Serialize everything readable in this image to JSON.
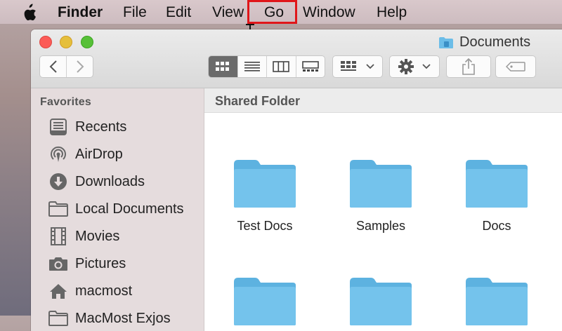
{
  "menubar": {
    "app_name": "Finder",
    "items": [
      "File",
      "Edit",
      "View",
      "Go",
      "Window",
      "Help"
    ],
    "highlighted_item": "Go",
    "highlight_color": "#e0161a"
  },
  "window": {
    "title": "Documents",
    "traffic_lights": [
      "#fc5b57",
      "#e5bf3c",
      "#57c038"
    ],
    "toolbar": {
      "view_modes": [
        "icon-view",
        "list-view",
        "column-view",
        "gallery-view"
      ],
      "active_view": "icon-view"
    }
  },
  "sidebar": {
    "header": "Favorites",
    "items": [
      {
        "label": "Recents",
        "icon": "recents-icon"
      },
      {
        "label": "AirDrop",
        "icon": "airdrop-icon"
      },
      {
        "label": "Downloads",
        "icon": "downloads-icon"
      },
      {
        "label": "Local Documents",
        "icon": "folder-icon"
      },
      {
        "label": "Movies",
        "icon": "movies-icon"
      },
      {
        "label": "Pictures",
        "icon": "camera-icon"
      },
      {
        "label": "macmost",
        "icon": "home-icon"
      },
      {
        "label": "MacMost Exjos",
        "icon": "folder-icon"
      }
    ]
  },
  "content": {
    "path_title": "Shared Folder",
    "folders": [
      {
        "label": "Test Docs"
      },
      {
        "label": "Samples"
      },
      {
        "label": "Docs"
      },
      {
        "label": ""
      },
      {
        "label": ""
      },
      {
        "label": ""
      }
    ],
    "folder_color": "#6cbde8"
  }
}
